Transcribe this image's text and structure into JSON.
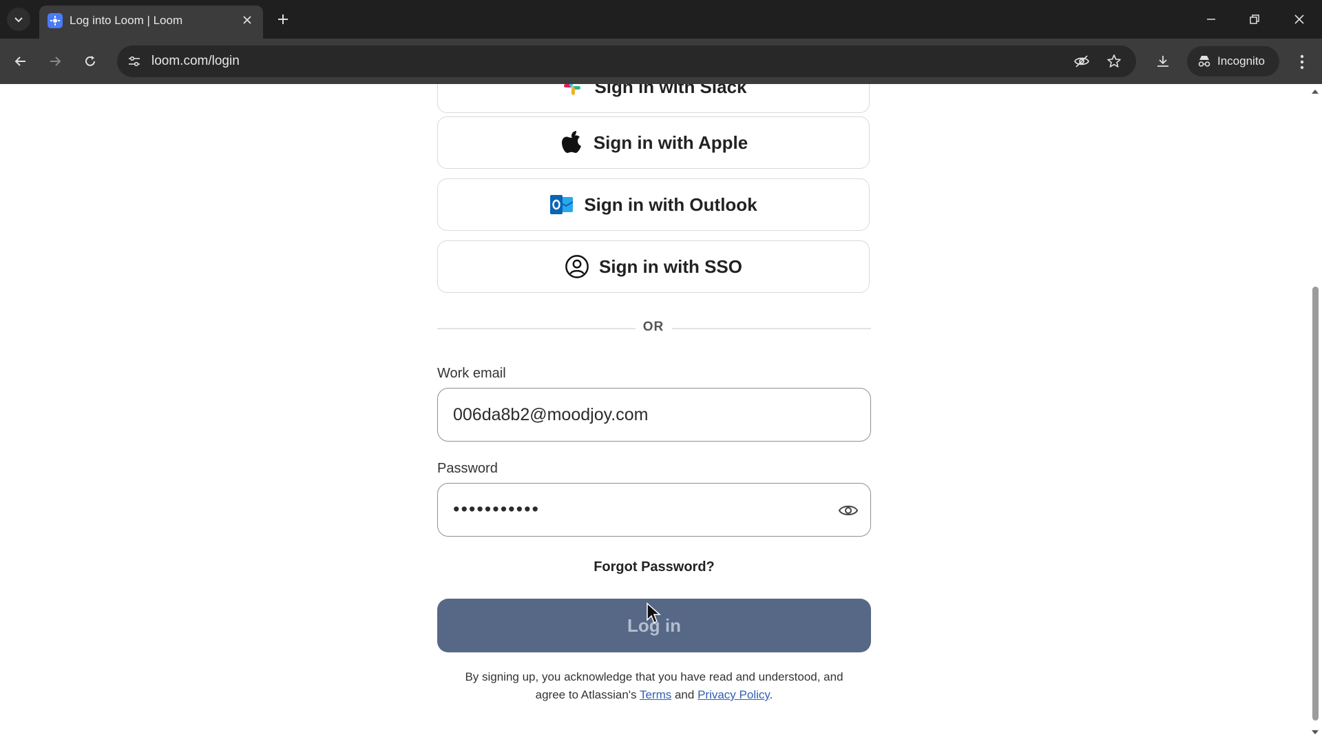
{
  "browser": {
    "tab": {
      "title": "Log into Loom | Loom"
    },
    "url": "loom.com/login",
    "incognito_label": "Incognito"
  },
  "login": {
    "providers": [
      {
        "label": "Sign in with Slack",
        "icon": "slack-icon"
      },
      {
        "label": "Sign in with Apple",
        "icon": "apple-icon"
      },
      {
        "label": "Sign in with Outlook",
        "icon": "outlook-icon"
      },
      {
        "label": "Sign in with SSO",
        "icon": "user-circle-icon"
      }
    ],
    "divider_text": "OR",
    "email_label": "Work email",
    "email_value": "006da8b2@moodjoy.com",
    "password_label": "Password",
    "password_value": "•••••••••••",
    "forgot_password": "Forgot Password?",
    "login_button": "Log in",
    "legal_line1": "By signing up, you acknowledge that you have read and understood, and",
    "legal_prefix": "agree to Atlassian's",
    "terms_link": "Terms",
    "legal_and": "and",
    "privacy_link": "Privacy Policy",
    "legal_suffix": "."
  },
  "colors": {
    "login_button_bg": "#566886",
    "link": "#2f5fb3",
    "outlook_blue": "#0a64b8",
    "tab_favicon": "#4a7bf7"
  }
}
